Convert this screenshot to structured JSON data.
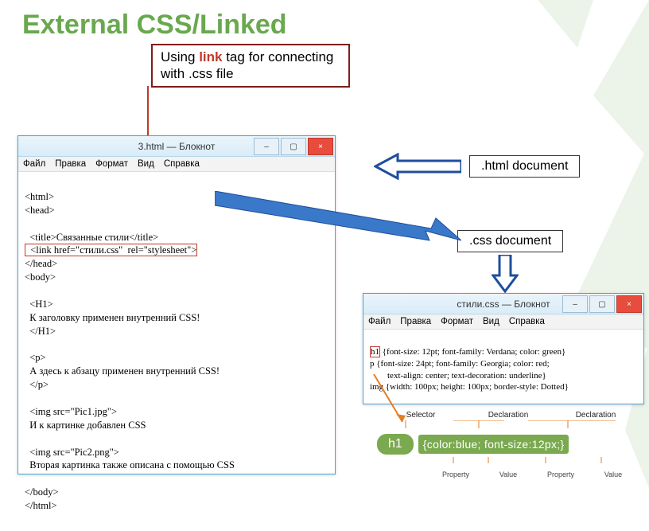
{
  "slide": {
    "title": "External CSS/Linked",
    "callout_prefix": "Using ",
    "callout_keyword": "link",
    "callout_suffix": " tag for connecting with .css file",
    "label_html": ".html document",
    "label_css": ".css document"
  },
  "html_window": {
    "title": "3.html — Блокнот",
    "menu": [
      "Файл",
      "Правка",
      "Формат",
      "Вид",
      "Справка"
    ],
    "controls": {
      "min": "–",
      "max": "▢",
      "close": "×"
    },
    "code_lines": [
      "<html>",
      "<head>",
      "",
      "  <title>Связанные стили</title>",
      "  <link href=\"стили.css\"  rel=\"stylesheet\">",
      "</head>",
      "<body>",
      "",
      "  <H1>",
      "  К заголовку применен внутренний CSS!",
      "  </H1>",
      "",
      "  <p>",
      "  А здесь к абзацу применен внутренний CSS!",
      "  </p>",
      "",
      "  <img src=\"Pic1.jpg\">",
      "  И к картинке добавлен CSS",
      "",
      "  <img src=\"Pic2.png\">",
      "  Вторая картинка также описана с помощью CSS",
      "",
      "</body>",
      "</html>"
    ]
  },
  "css_window": {
    "title": "стили.css — Блокнот",
    "menu": [
      "Файл",
      "Правка",
      "Формат",
      "Вид",
      "Справка"
    ],
    "controls": {
      "min": "–",
      "max": "▢",
      "close": "×"
    },
    "code_lines": [
      "h1 {font-size: 12pt; font-family: Verdana; color: green}",
      "p {font-size: 24pt; font-family: Georgia; color: red;",
      "        text-align: center; text-decoration: underline}",
      "img {width: 100px; height: 100px; border-style: Dotted}"
    ]
  },
  "rule": {
    "selector": "h1",
    "decl_open": "{",
    "decl_close": "}",
    "prop1": "color",
    "val1": "blue",
    "prop2": "font-size",
    "val2": "12px",
    "label_selector": "Selector",
    "label_declaration": "Declaration",
    "label_property": "Property",
    "label_value": "Value"
  }
}
